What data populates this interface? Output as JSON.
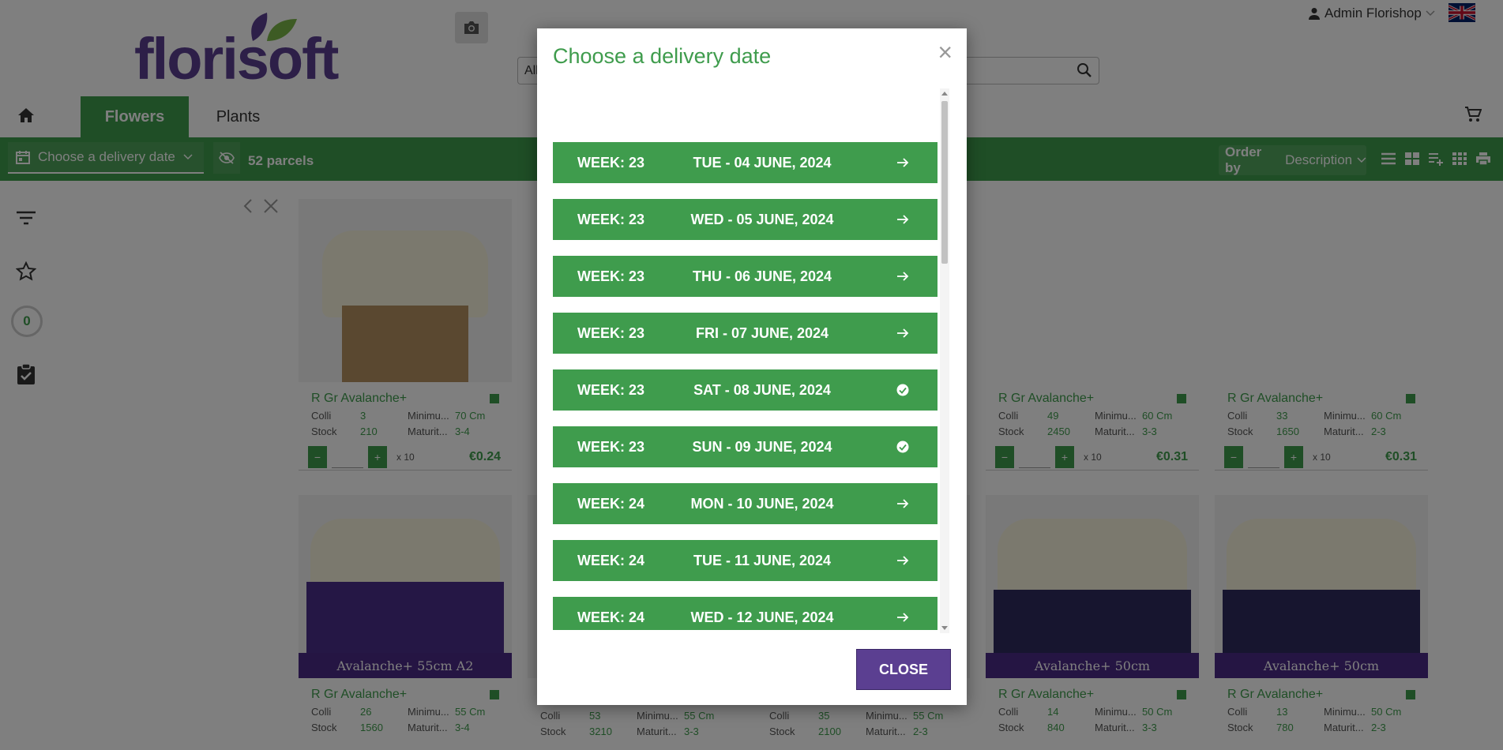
{
  "header": {
    "logo_text": "florisoft",
    "search_category": "All",
    "user_name": "Admin Florishop"
  },
  "nav": {
    "tabs": [
      {
        "label": "Flowers",
        "active": true
      },
      {
        "label": "Plants",
        "active": false
      }
    ]
  },
  "toolbar": {
    "delivery_placeholder": "Choose a delivery date",
    "parcels": "52 parcels",
    "order_by_label": "Order by",
    "order_by_value": "Description"
  },
  "sidebar": {
    "counter": "0"
  },
  "products": [
    {
      "name": "R Gr Avalanche+",
      "colli": "3",
      "stock": "210",
      "minimum": "70 Cm",
      "maturity": "3-4",
      "price": "€0.24",
      "band": ""
    },
    {
      "name": "R Gr Avalanche+",
      "colli": "49",
      "stock": "2450",
      "minimum": "60 Cm",
      "maturity": "3-3",
      "price": "€0.31",
      "band": ""
    },
    {
      "name": "R Gr Avalanche+",
      "colli": "33",
      "stock": "1650",
      "minimum": "60 Cm",
      "maturity": "2-3",
      "price": "€0.31",
      "band": ""
    },
    {
      "name": "R Gr Avalanche+",
      "colli": "26",
      "stock": "1560",
      "minimum": "55 Cm",
      "maturity": "3-4",
      "price": "",
      "band": "Avalanche+ 55cm A2"
    },
    {
      "name": "R Gr Avalanche+",
      "colli": "14",
      "stock": "840",
      "minimum": "50 Cm",
      "maturity": "3-3",
      "price": "",
      "band": "Avalanche+ 50cm"
    },
    {
      "name": "R Gr Avalanche+",
      "colli": "13",
      "stock": "780",
      "minimum": "50 Cm",
      "maturity": "2-3",
      "price": "",
      "band": "Avalanche+ 50cm"
    }
  ],
  "hidden_products_visible_values": [
    {
      "colli": "53",
      "stock": "3210",
      "minimum": "55 Cm",
      "maturity": "3-3"
    },
    {
      "colli": "35",
      "stock": "2100",
      "minimum": "55 Cm",
      "maturity": "2-3"
    }
  ],
  "labels": {
    "colli": "Colli",
    "stock": "Stock",
    "minimum": "Minimu...",
    "maturity": "Maturit...",
    "multiplier": "x 10"
  },
  "modal": {
    "title": "Choose a delivery date",
    "close_label": "CLOSE",
    "dates": [
      {
        "week": "WEEK: 23",
        "date": "TUE - 04 JUNE, 2024",
        "icon": "arrow-right"
      },
      {
        "week": "WEEK: 23",
        "date": "WED - 05 JUNE, 2024",
        "icon": "arrow-right"
      },
      {
        "week": "WEEK: 23",
        "date": "THU - 06 JUNE, 2024",
        "icon": "arrow-right"
      },
      {
        "week": "WEEK: 23",
        "date": "FRI - 07 JUNE, 2024",
        "icon": "arrow-right"
      },
      {
        "week": "WEEK: 23",
        "date": "SAT - 08 JUNE, 2024",
        "icon": "check-circle"
      },
      {
        "week": "WEEK: 23",
        "date": "SUN - 09 JUNE, 2024",
        "icon": "check-circle"
      },
      {
        "week": "WEEK: 24",
        "date": "MON - 10 JUNE, 2024",
        "icon": "arrow-right"
      },
      {
        "week": "WEEK: 24",
        "date": "TUE - 11 JUNE, 2024",
        "icon": "arrow-right"
      },
      {
        "week": "WEEK: 24",
        "date": "WED - 12 JUNE, 2024",
        "icon": "arrow-right"
      }
    ]
  },
  "colors": {
    "brand_green": "#3f9c4d",
    "brand_purple": "#5b3f91"
  }
}
